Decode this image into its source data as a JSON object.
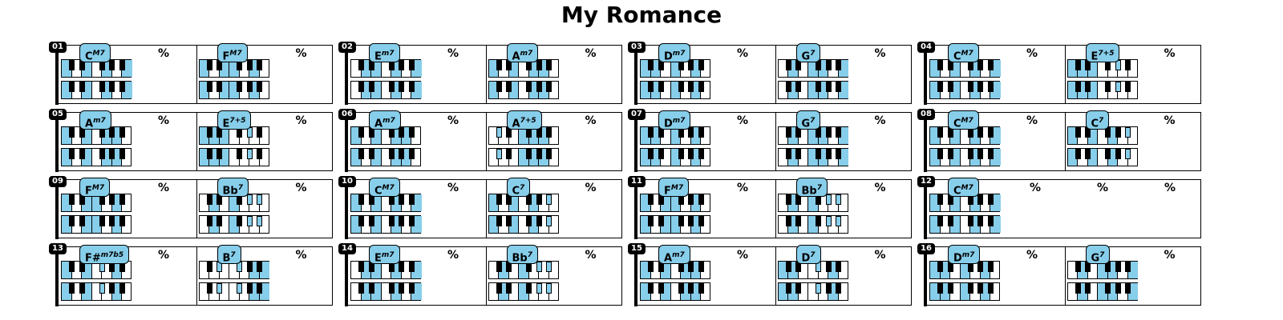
{
  "title": "My Romance",
  "repeat_symbol": "%",
  "colors": {
    "highlight": "#87ceeb",
    "black_key": "#000000",
    "white_key": "#ffffff"
  },
  "measures": [
    {
      "number": "01",
      "chords": [
        {
          "root": "C",
          "quality": "M7",
          "notes": [
            "C",
            "E",
            "G",
            "B"
          ]
        },
        {
          "root": "F",
          "quality": "M7",
          "notes": [
            "F",
            "A",
            "C",
            "E"
          ]
        }
      ]
    },
    {
      "number": "02",
      "chords": [
        {
          "root": "E",
          "quality": "m7",
          "notes": [
            "E",
            "G",
            "B",
            "D"
          ]
        },
        {
          "root": "A",
          "quality": "m7",
          "notes": [
            "A",
            "C",
            "E",
            "G"
          ]
        }
      ]
    },
    {
      "number": "03",
      "chords": [
        {
          "root": "D",
          "quality": "m7",
          "notes": [
            "D",
            "F",
            "A",
            "C"
          ]
        },
        {
          "root": "G",
          "quality": "7",
          "notes": [
            "G",
            "B",
            "D",
            "F"
          ]
        }
      ]
    },
    {
      "number": "04",
      "chords": [
        {
          "root": "C",
          "quality": "M7",
          "notes": [
            "C",
            "E",
            "G",
            "B"
          ]
        },
        {
          "root": "E",
          "quality": "7+5",
          "notes": [
            "E",
            "G#",
            "C",
            "D"
          ]
        }
      ]
    },
    {
      "number": "05",
      "chords": [
        {
          "root": "A",
          "quality": "m7",
          "notes": [
            "A",
            "C",
            "E",
            "G"
          ]
        },
        {
          "root": "E",
          "quality": "7+5",
          "notes": [
            "E",
            "G#",
            "C",
            "D"
          ]
        }
      ]
    },
    {
      "number": "06",
      "chords": [
        {
          "root": "A",
          "quality": "m7",
          "notes": [
            "A",
            "C",
            "E",
            "G"
          ]
        },
        {
          "root": "A",
          "quality": "7+5",
          "notes": [
            "A",
            "C#",
            "F",
            "G"
          ]
        }
      ]
    },
    {
      "number": "07",
      "chords": [
        {
          "root": "D",
          "quality": "m7",
          "notes": [
            "D",
            "F",
            "A",
            "C"
          ]
        },
        {
          "root": "G",
          "quality": "7",
          "notes": [
            "G",
            "B",
            "D",
            "F"
          ]
        }
      ]
    },
    {
      "number": "08",
      "chords": [
        {
          "root": "C",
          "quality": "M7",
          "notes": [
            "C",
            "E",
            "G",
            "B"
          ]
        },
        {
          "root": "C",
          "quality": "7",
          "notes": [
            "C",
            "E",
            "G",
            "A#"
          ]
        }
      ]
    },
    {
      "number": "09",
      "chords": [
        {
          "root": "F",
          "quality": "M7",
          "notes": [
            "F",
            "A",
            "C",
            "E"
          ]
        },
        {
          "root": "Bb",
          "quality": "7",
          "notes": [
            "A#",
            "D",
            "F",
            "G#"
          ]
        }
      ]
    },
    {
      "number": "10",
      "chords": [
        {
          "root": "C",
          "quality": "M7",
          "notes": [
            "C",
            "E",
            "G",
            "B"
          ]
        },
        {
          "root": "C",
          "quality": "7",
          "notes": [
            "C",
            "E",
            "G",
            "A#"
          ]
        }
      ]
    },
    {
      "number": "11",
      "chords": [
        {
          "root": "F",
          "quality": "M7",
          "notes": [
            "F",
            "A",
            "C",
            "E"
          ]
        },
        {
          "root": "Bb",
          "quality": "7",
          "notes": [
            "A#",
            "D",
            "F",
            "G#"
          ]
        }
      ]
    },
    {
      "number": "12",
      "chords": [
        {
          "root": "C",
          "quality": "M7",
          "notes": [
            "C",
            "E",
            "G",
            "B"
          ]
        }
      ]
    },
    {
      "number": "13",
      "chords": [
        {
          "root": "F#",
          "quality": "m7b5",
          "notes": [
            "F#",
            "A",
            "C",
            "E"
          ]
        },
        {
          "root": "B",
          "quality": "7",
          "notes": [
            "B",
            "D#",
            "F#",
            "A"
          ]
        }
      ]
    },
    {
      "number": "14",
      "chords": [
        {
          "root": "E",
          "quality": "m7",
          "notes": [
            "E",
            "G",
            "B",
            "D"
          ]
        },
        {
          "root": "Bb",
          "quality": "7",
          "notes": [
            "A#",
            "D",
            "F",
            "G#"
          ]
        }
      ]
    },
    {
      "number": "15",
      "chords": [
        {
          "root": "A",
          "quality": "m7",
          "notes": [
            "A",
            "C",
            "E",
            "G"
          ]
        },
        {
          "root": "D",
          "quality": "7",
          "notes": [
            "D",
            "F#",
            "A",
            "C"
          ]
        }
      ]
    },
    {
      "number": "16",
      "chords": [
        {
          "root": "D",
          "quality": "m7",
          "notes": [
            "D",
            "F",
            "A",
            "C"
          ]
        },
        {
          "root": "G",
          "quality": "7",
          "notes": [
            "G",
            "B",
            "D",
            "F"
          ]
        }
      ]
    }
  ]
}
